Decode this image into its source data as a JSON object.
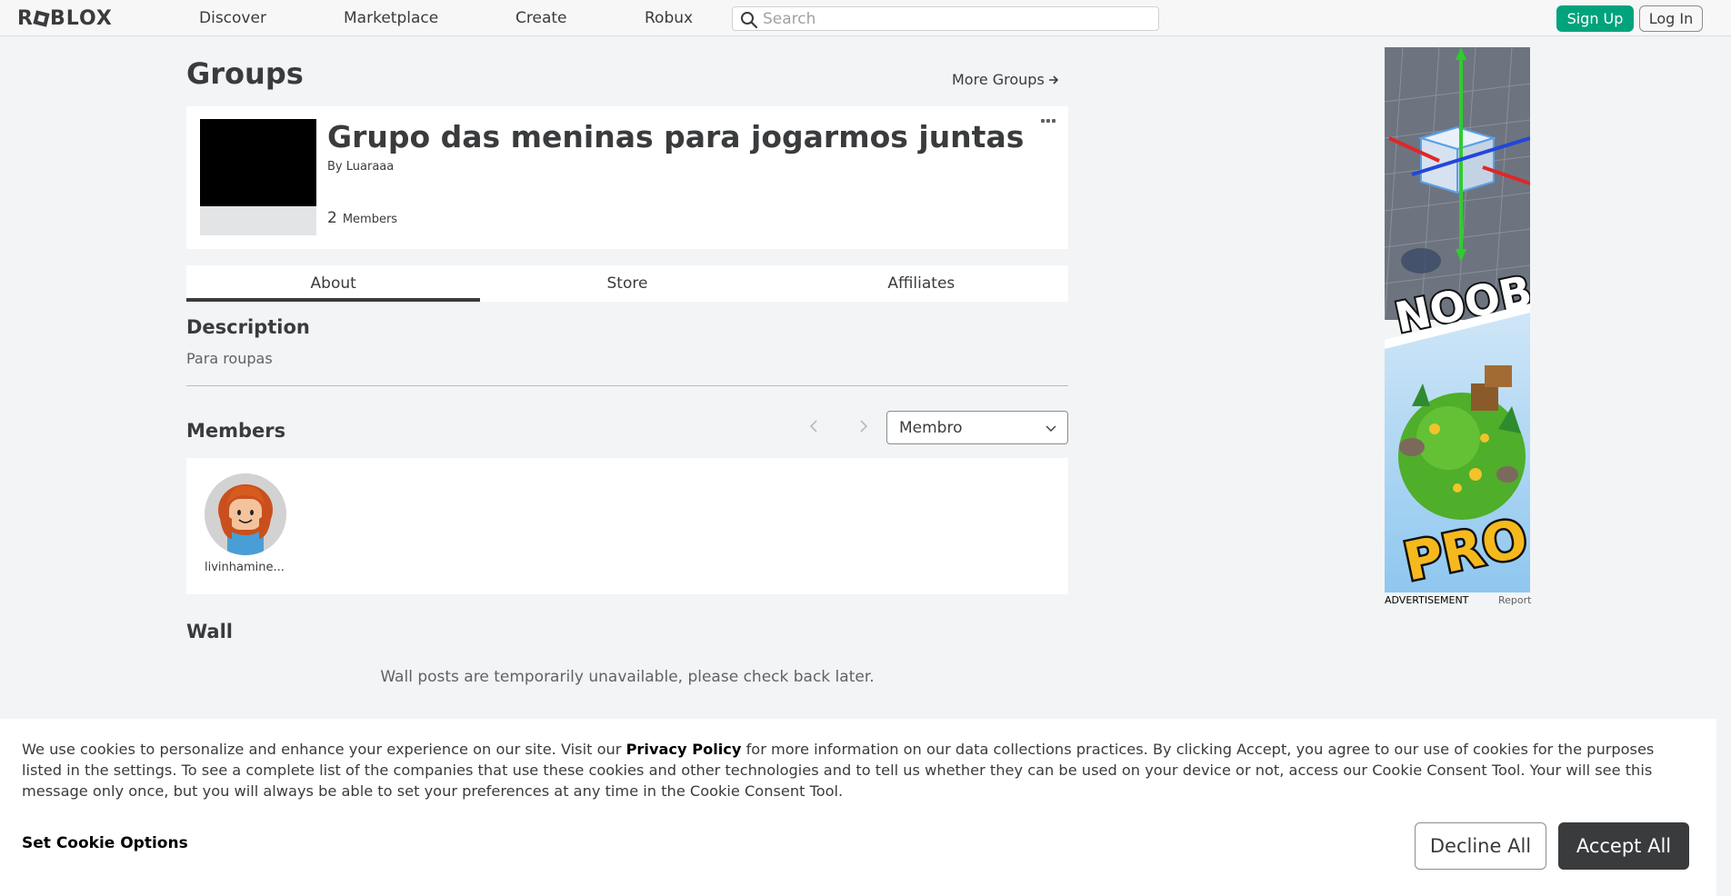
{
  "header": {
    "logo_text_pre": "R",
    "logo_text_post": "BLOX",
    "nav": [
      "Discover",
      "Marketplace",
      "Create",
      "Robux"
    ],
    "search_placeholder": "Search",
    "signup_label": "Sign Up",
    "login_label": "Log In"
  },
  "page": {
    "title": "Groups",
    "more_groups": "More Groups"
  },
  "group": {
    "name": "Grupo das meninas para jogarmos juntas",
    "by_label": "By",
    "owner": "Luaraaa",
    "member_count": "2",
    "members_label": "Members"
  },
  "tabs": [
    {
      "label": "About",
      "active": true
    },
    {
      "label": "Store",
      "active": false
    },
    {
      "label": "Affiliates",
      "active": false
    }
  ],
  "about": {
    "description_heading": "Description",
    "description_text": "Para roupas",
    "members_heading": "Members",
    "role_selected": "Membro",
    "members": [
      {
        "name": "livinhamine..."
      }
    ],
    "wall_heading": "Wall",
    "wall_message": "Wall posts are temporarily unavailable, please check back later."
  },
  "ad": {
    "label": "ADVERTISEMENT",
    "report": "Report",
    "text_top": "NOOB",
    "text_bottom": "PRO"
  },
  "cookie": {
    "text_before": "We use cookies to personalize and enhance your experience on our site. Visit our ",
    "privacy_link": "Privacy Policy",
    "text_after": " for more information on our data collections practices. By clicking Accept, you agree to our use of cookies for the purposes listed in the settings. To see a complete list of the companies that use these cookies and other technologies and to tell us whether they can be used on your device or not, access our Cookie Consent Tool. Your will see this message only once, but you will always be able to set your preferences at any time in the Cookie Consent Tool.",
    "options_label": "Set Cookie Options",
    "decline_label": "Decline All",
    "accept_label": "Accept All"
  },
  "colors": {
    "brand_green": "#00a37c",
    "text_dark": "#393b3d",
    "page_bg": "#f2f4f5"
  }
}
